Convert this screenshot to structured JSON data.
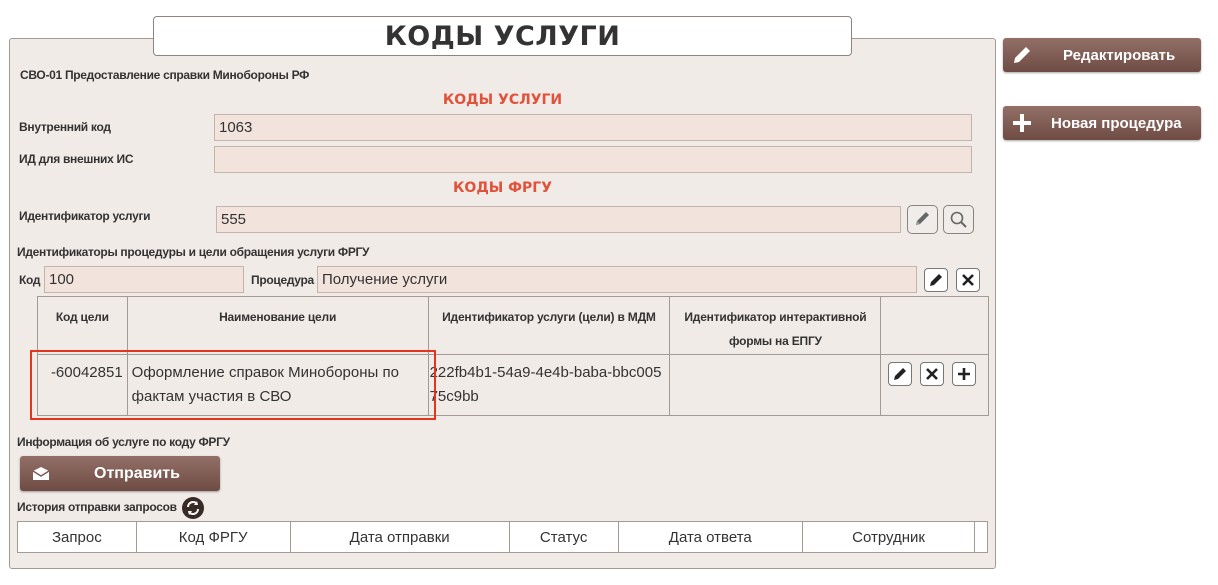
{
  "title": "КОДЫ УСЛУГИ",
  "service_name": "СВО-01 Предоставление справки Минобороны РФ",
  "section_codes": "КОДЫ УСЛУГИ",
  "internal_code": {
    "label": "Внутренний код",
    "value": "1063"
  },
  "external_id": {
    "label": "ИД для внешних ИС",
    "value": ""
  },
  "section_frgu": "КОДЫ ФРГУ",
  "service_identifier": {
    "label": "Идентификатор услуги",
    "value": "555"
  },
  "procedure_section_label": "Идентификаторы процедуры и цели обращения услуги ФРГУ",
  "procedure": {
    "code_label": "Код",
    "code_value": "100",
    "procedure_label": "Процедура",
    "procedure_value": "Получение услуги"
  },
  "goals_table": {
    "headers": [
      "Код цели",
      "Наименование цели",
      "Идентификатор услуги (цели) в МДМ",
      "Идентификатор интерактивной формы на ЕПГУ"
    ],
    "rows": [
      {
        "code": "-60042851",
        "name": "Оформление справок Минобороны по фактам участия в СВО",
        "mdm_id": "222fb4b1-54a9-4e4b-baba-bbc00575c9bb",
        "epgu_id": ""
      }
    ]
  },
  "frgu_info_label": "Информация об услуге по коду ФРГУ",
  "send_button": "Отправить",
  "history_label": "История отправки запросов",
  "history_headers": [
    "Запрос",
    "Код ФРГУ",
    "Дата отправки",
    "Статус",
    "Дата ответа",
    "Сотрудник"
  ],
  "side_buttons": {
    "edit": "Редактировать",
    "new_procedure": "Новая процедура"
  },
  "colors": {
    "accent_red": "#e0533a",
    "button_brown": "#7d5a51",
    "panel_bg": "#f1ebe8",
    "field_bg": "#f2e3dc",
    "highlight": "#e3341e"
  }
}
